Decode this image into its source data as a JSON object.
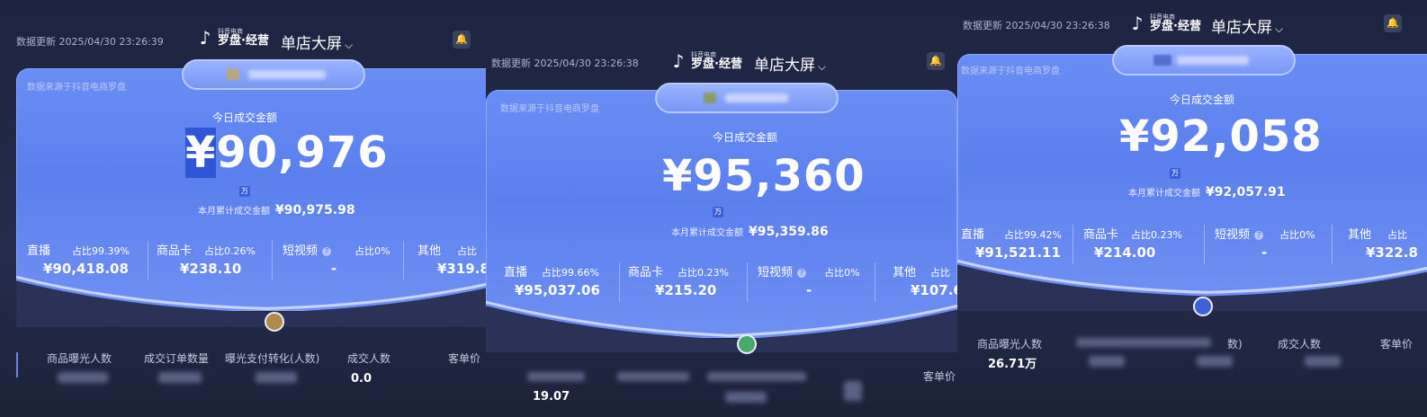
{
  "colors": {
    "card_blue": "#5b7fee",
    "background": "#1d2440",
    "accent_selection": "#3056d6"
  },
  "icons": {
    "logo": "tiktok-note-icon",
    "bell": "bell-icon",
    "dropdown": "chevron-down-icon",
    "info": "info-icon"
  },
  "panels": [
    {
      "update": "数据更新 2025/04/30 23:26:39",
      "logo_small": "抖音电商",
      "logo_text": "罗盘·经营",
      "title": "单店大屏",
      "source": "数据来源于抖音电商罗盘",
      "today_label": "今日成交金额",
      "yen": "¥",
      "amount": "90,976",
      "wan": "万",
      "month_label": "本月累计成交金额",
      "month_value": "¥90,975.98",
      "metrics": [
        {
          "name": "直播",
          "share": "占比99.39%",
          "value": "¥90,418.08"
        },
        {
          "name": "商品卡",
          "share": "占比0.26%",
          "value": "¥238.10"
        },
        {
          "name": "短视频",
          "share": "占比0%",
          "value": "-"
        },
        {
          "name": "其他",
          "share": "占比",
          "value": "¥319.8"
        }
      ],
      "bottom": [
        {
          "label": "商品曝光人数",
          "value": ""
        },
        {
          "label": "成交订单数量",
          "value": ""
        },
        {
          "label": "曝光支付转化(人数)",
          "value": ""
        },
        {
          "label": "成交人数",
          "value": "0.0"
        },
        {
          "label": "客单价",
          "value": ""
        }
      ]
    },
    {
      "update": "数据更新 2025/04/30 23:26:38",
      "logo_small": "抖音电商",
      "logo_text": "罗盘·经营",
      "title": "单店大屏",
      "source": "数据来源于抖音电商罗盘",
      "today_label": "今日成交金额",
      "yen": "¥",
      "amount": "95,360",
      "wan": "万",
      "month_label": "本月累计成交金额",
      "month_value": "¥95,359.86",
      "metrics": [
        {
          "name": "直播",
          "share": "占比99.66%",
          "value": "¥95,037.06"
        },
        {
          "name": "商品卡",
          "share": "占比0.23%",
          "value": "¥215.20"
        },
        {
          "name": "短视频",
          "share": "占比0%",
          "value": "-"
        },
        {
          "name": "其他",
          "share": "占比",
          "value": "¥107.6"
        }
      ],
      "bottom": [
        {
          "label": "商品曝光人数",
          "value": "19.07"
        },
        {
          "label": "成交订单数量",
          "value": ""
        },
        {
          "label": "",
          "value": ""
        },
        {
          "label": "",
          "value": ""
        },
        {
          "label": "客单价",
          "value": ""
        }
      ]
    },
    {
      "update": "数据更新 2025/04/30 23:26:38",
      "logo_small": "抖音电商",
      "logo_text": "罗盘·经营",
      "title": "单店大屏",
      "source": "数据来源于抖音电商罗盘",
      "today_label": "今日成交金额",
      "yen": "¥",
      "amount": "92,058",
      "wan": "万",
      "month_label": "本月累计成交金额",
      "month_value": "¥92,057.91",
      "metrics": [
        {
          "name": "直播",
          "share": "占比99.42%",
          "value": "¥91,521.11"
        },
        {
          "name": "商品卡",
          "share": "占比0.23%",
          "value": "¥214.00"
        },
        {
          "name": "短视频",
          "share": "占比0%",
          "value": "-"
        },
        {
          "name": "其他",
          "share": "占比",
          "value": "¥322.8"
        }
      ],
      "bottom": [
        {
          "label": "商品曝光人数",
          "value": "26.71万"
        },
        {
          "label": "",
          "value": ""
        },
        {
          "label": "数)",
          "value": ""
        },
        {
          "label": "成交人数",
          "value": ""
        },
        {
          "label": "客单价",
          "value": ""
        }
      ]
    }
  ]
}
